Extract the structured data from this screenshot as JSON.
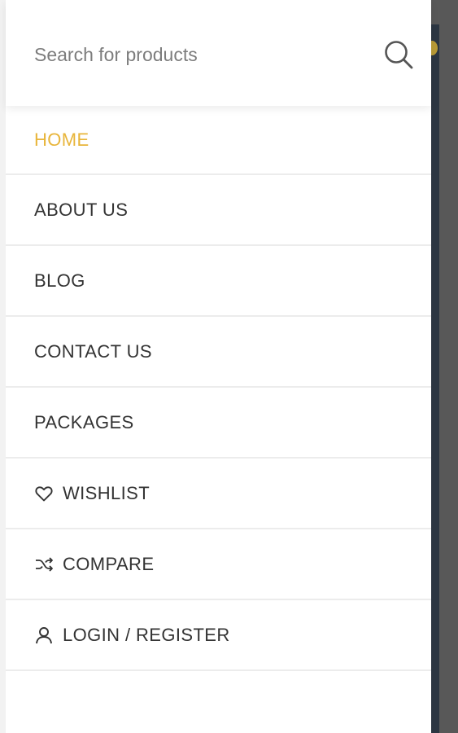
{
  "colors": {
    "accent": "#e8b53a",
    "text": "#333333",
    "placeholder": "#7d7d7d",
    "divider": "#ececec"
  },
  "search": {
    "placeholder": "Search for products",
    "value": "",
    "icon": "search-icon"
  },
  "menu": {
    "items": [
      {
        "label": "HOME",
        "active": true
      },
      {
        "label": "ABOUT US"
      },
      {
        "label": "BLOG"
      },
      {
        "label": "CONTACT US"
      },
      {
        "label": "PACKAGES"
      },
      {
        "label": "WISHLIST",
        "icon": "heart-icon"
      },
      {
        "label": "COMPARE",
        "icon": "shuffle-icon"
      },
      {
        "label": "LOGIN / REGISTER",
        "icon": "user-icon"
      }
    ]
  }
}
